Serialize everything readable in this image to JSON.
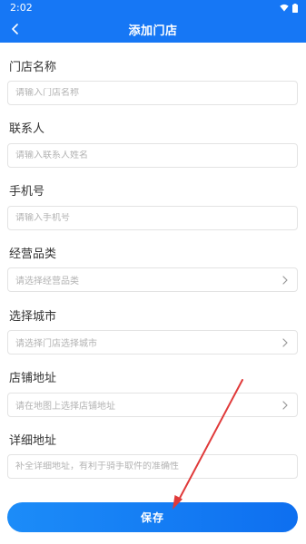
{
  "status_bar": {
    "time": "2:02"
  },
  "header": {
    "title": "添加门店"
  },
  "form": {
    "store_name": {
      "label": "门店名称",
      "placeholder": "请输入门店名称"
    },
    "contact": {
      "label": "联系人",
      "placeholder": "请输入联系人姓名"
    },
    "phone": {
      "label": "手机号",
      "placeholder": "请输入手机号"
    },
    "category": {
      "label": "经营品类",
      "placeholder": "请选择经营品类"
    },
    "city": {
      "label": "选择城市",
      "placeholder": "请选择门店选择城市"
    },
    "address": {
      "label": "店铺地址",
      "placeholder": "请在地图上选择店铺地址"
    },
    "detail_address": {
      "label": "详细地址",
      "placeholder": "补全详细地址，有利于骑手取件的准确性"
    }
  },
  "save_label": "保存",
  "colors": {
    "primary": "#1677f5",
    "annotation_arrow": "#e03a3a"
  },
  "icons": [
    "back-arrow-icon",
    "wifi-icon",
    "battery-icon",
    "chevron-right-icon"
  ]
}
